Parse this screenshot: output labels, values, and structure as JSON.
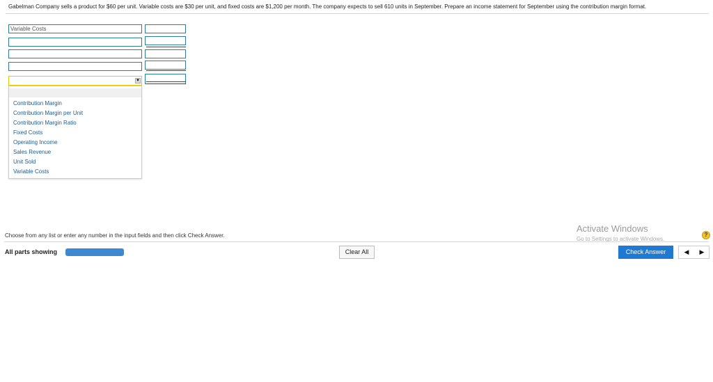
{
  "problem": {
    "text": "Gabelman Company sells a product for $60 per unit. Variable costs are $30 per unit, and fixed costs are $1,200 per month. The company expects to sell 610 units in September. Prepare an income statement for September using the contribution margin format."
  },
  "statement": {
    "rows": [
      {
        "label_value": "Variable Costs",
        "amount_value": ""
      },
      {
        "label_value": "",
        "amount_value": ""
      },
      {
        "label_value": "",
        "amount_value": ""
      },
      {
        "label_value": "",
        "amount_value": ""
      }
    ],
    "select": {
      "value": "",
      "arrow_icon": "dropdown-arrow-icon"
    }
  },
  "dropdown": {
    "options": [
      "",
      "Contribution Margin",
      "Contribution Margin per Unit",
      "Contribution Margin Ratio",
      "Fixed Costs",
      "Operating Income",
      "Sales Revenue",
      "Unit Sold",
      "Variable Costs"
    ]
  },
  "footer": {
    "instruction": "Choose from any list or enter any number in the input fields and then click Check Answer.",
    "parts_label": "All parts showing",
    "progress_fraction": 1.0,
    "clear_label": "Clear All",
    "check_label": "Check Answer",
    "prev_glyph": "◀",
    "next_glyph": "▶",
    "help_glyph": "?"
  },
  "watermark": {
    "title": "Activate Windows",
    "subtitle": "Go to Settings to activate Windows."
  }
}
